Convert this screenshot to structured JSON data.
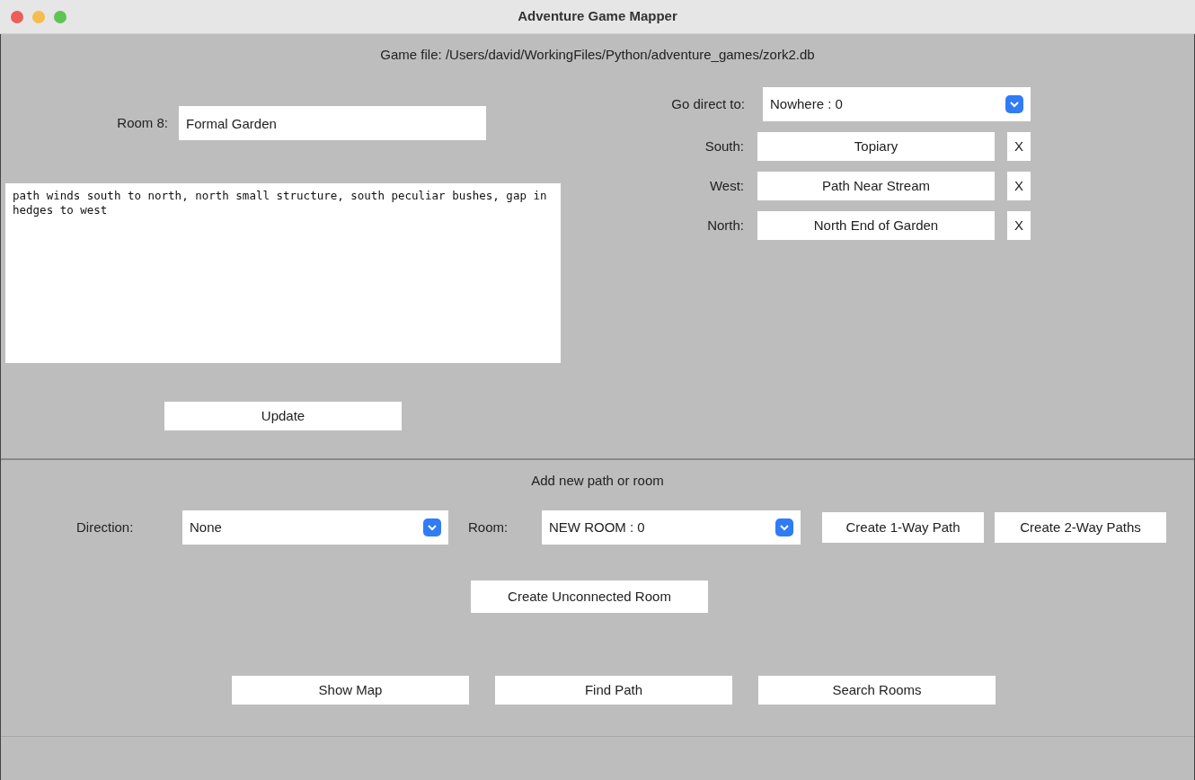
{
  "window": {
    "title": "Adventure Game Mapper"
  },
  "game_file": "Game file: /Users/david/WorkingFiles/Python/adventure_games/zork2.db",
  "room": {
    "label": "Room 8:",
    "name": "Formal Garden",
    "description": "path winds south to north, north small structure, south peculiar bushes, gap in hedges to west",
    "update_button": "Update"
  },
  "go_direct": {
    "label": "Go direct to:",
    "value": "Nowhere : 0"
  },
  "exits": [
    {
      "direction": "South:",
      "room": "Topiary",
      "remove": "X"
    },
    {
      "direction": "West:",
      "room": "Path Near Stream",
      "remove": "X"
    },
    {
      "direction": "North:",
      "room": "North End of Garden",
      "remove": "X"
    }
  ],
  "add_section": {
    "heading": "Add new path or room",
    "direction_label": "Direction:",
    "direction_value": "None",
    "room_label": "Room:",
    "room_value": "NEW ROOM : 0",
    "path_buttons": [
      "Create 1-Way Path",
      "Create 2-Way Paths"
    ],
    "unconnected_button": "Create Unconnected Room"
  },
  "actions": [
    "Show Map",
    "Find Path",
    "Search Rooms"
  ]
}
